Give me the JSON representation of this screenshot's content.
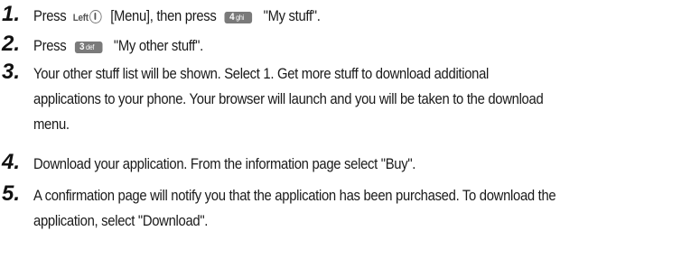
{
  "steps": [
    {
      "number": "1.",
      "segments": {
        "s1": "Press",
        "key_left": "Left",
        "s2": "[Menu], then press",
        "key_4_digit": "4",
        "key_4_letters": "ghi",
        "s3": "\"My stuff\"."
      }
    },
    {
      "number": "2.",
      "segments": {
        "s1": "Press",
        "key_3_digit": "3",
        "key_3_letters": "def",
        "s2": "\"My other stuff\"."
      }
    },
    {
      "number": "3.",
      "lines": [
        "Your other stuff list will be shown.  Select 1. Get more stuff to download additional",
        "applications to your phone.  Your browser will launch and you will be taken to the download",
        "menu."
      ]
    },
    {
      "number": "4.",
      "lines": [
        "Download your application.  From the information page select \"Buy\"."
      ]
    },
    {
      "number": "5.",
      "lines": [
        "A confirmation page will notify you that the application has been purchased.  To download the",
        "application, select \"Download\"."
      ]
    }
  ],
  "colors": {
    "key_fill": "#7a7a7a",
    "text": "#1a1a1a"
  }
}
